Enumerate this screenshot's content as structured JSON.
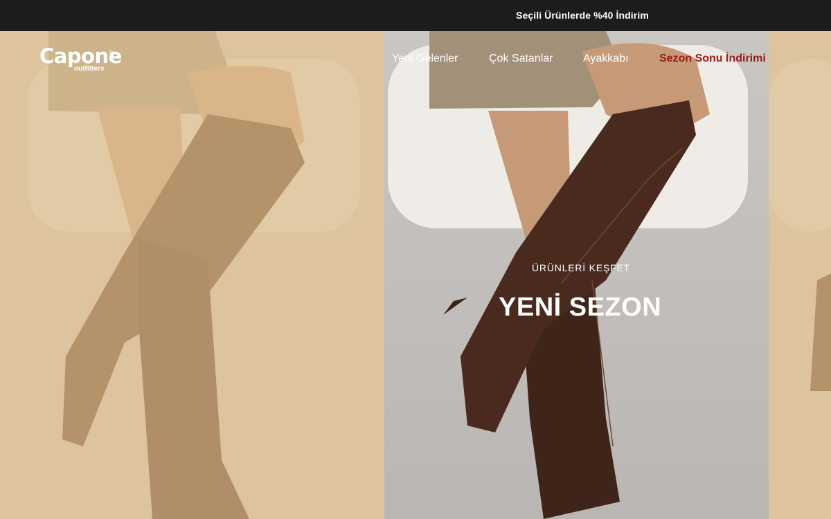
{
  "announcement": {
    "text": "Seçili Ürünlerde %40 İndirim"
  },
  "header": {
    "logo_main": "Capone",
    "logo_sub": "outfitters",
    "logo_mark": "®"
  },
  "nav": [
    {
      "label": "Yeni Gelenler"
    },
    {
      "label": "Çok Satanlar"
    },
    {
      "label": "Ayakkabı"
    },
    {
      "label": "Sezon Sonu İndirimi"
    }
  ],
  "hero": {
    "eyebrow": "ÜRÜNLERİ KEŞFET",
    "title": "YENİ SEZON"
  },
  "colors": {
    "topbar": "#1c1c1c",
    "sale_nav": "#9a1a16",
    "boot": "#4a2a1f",
    "overlay_tint": "#d8b98a"
  }
}
